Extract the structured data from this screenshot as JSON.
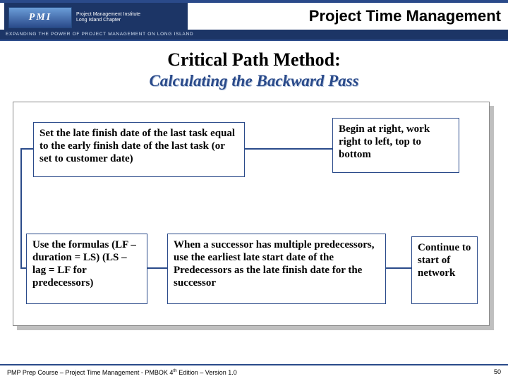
{
  "header": {
    "logo_acronym": "PMI",
    "logo_line1": "Project Management Institute",
    "logo_line2": "Long Island Chapter",
    "tagline": "EXPANDING THE POWER OF PROJECT MANAGEMENT ON LONG ISLAND",
    "title": "Project Time Management"
  },
  "titles": {
    "main": "Critical Path Method:",
    "sub": "Calculating the Backward Pass"
  },
  "boxes": {
    "a": "Set the late finish date of the last task equal to the early finish date of the last task\n (or set to customer date)",
    "b": "Begin at right, work right to left, top to bottom",
    "c": "Use the formulas\n(LF – duration = LS)\n(LS – lag = LF for predecessors)",
    "d": "When a successor has multiple predecessors, use the earliest late start date of the Predecessors as the late finish date for the successor",
    "e": "Continue to start of network"
  },
  "footer": {
    "left_pre": "PMP Prep Course – Project Time Management - PMBOK 4",
    "left_sup": "th",
    "left_post": " Edition – Version 1.0",
    "page": "50"
  }
}
